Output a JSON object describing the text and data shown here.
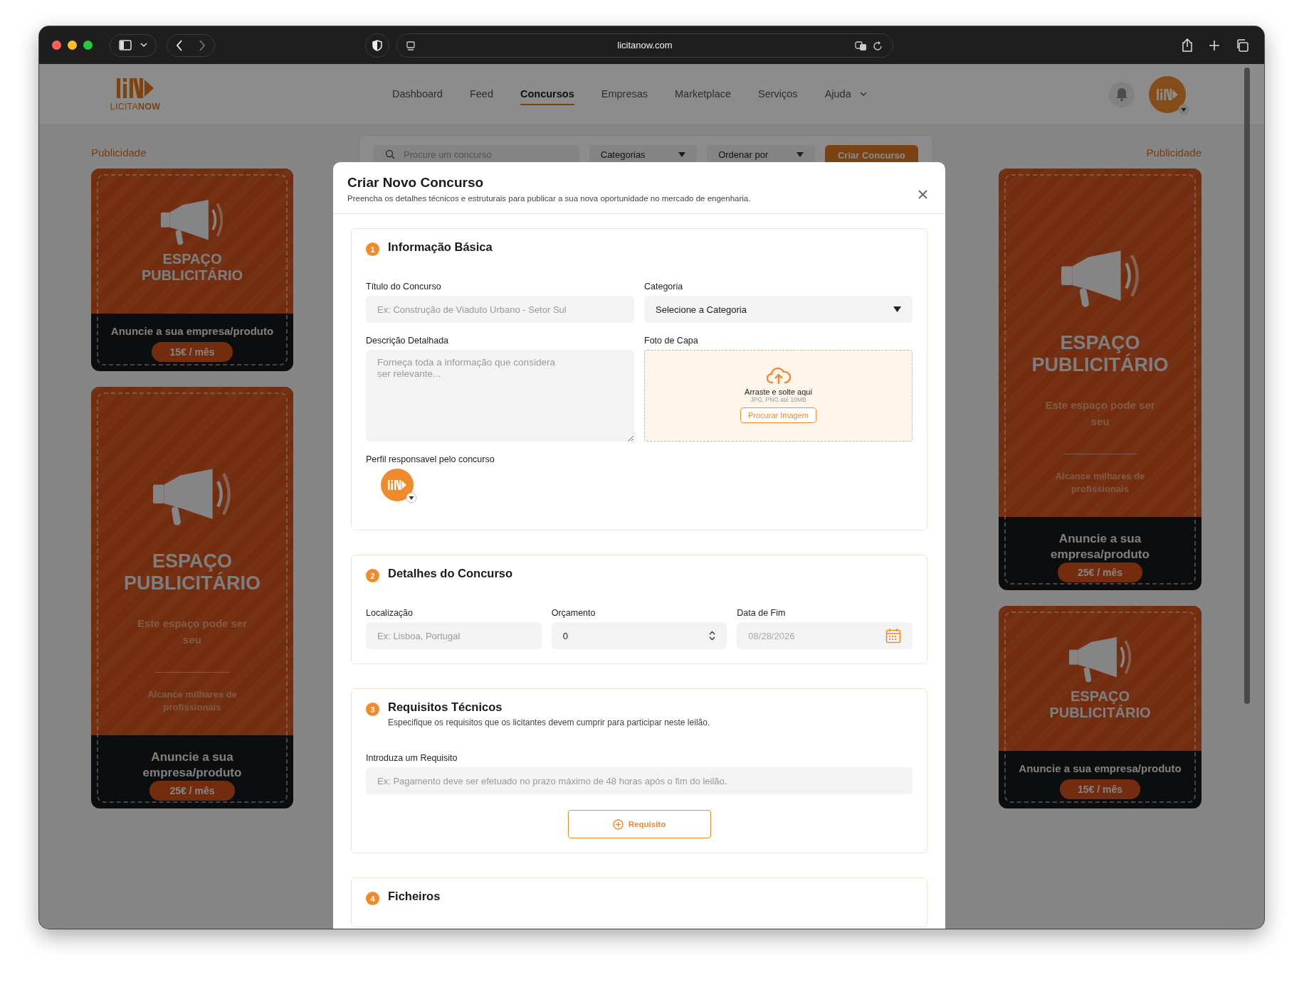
{
  "browser": {
    "url": "licitanow.com"
  },
  "header": {
    "brand": "LICITA**NOW**",
    "nav": [
      {
        "label": "Dashboard",
        "selected": false,
        "has_menu": false
      },
      {
        "label": "Feed",
        "selected": false,
        "has_menu": false
      },
      {
        "label": "Concursos",
        "selected": true,
        "has_menu": false
      },
      {
        "label": "Empresas",
        "selected": false,
        "has_menu": false
      },
      {
        "label": "Marketplace",
        "selected": false,
        "has_menu": false
      },
      {
        "label": "Serviços",
        "selected": false,
        "has_menu": false
      },
      {
        "label": "Ajuda",
        "selected": false,
        "has_menu": true
      }
    ]
  },
  "filters": {
    "search_placeholder": "Procure um concurso",
    "category": "Categorias",
    "sort": "Ordenar por",
    "create_button": "Criar Concurso"
  },
  "ads_left": {
    "label": "Publicidade",
    "ads": [
      {
        "kind": "small",
        "title": "ESPAÇO PUBLICITÁRIO",
        "cta": "Anuncie a sua empresa/produto",
        "price": "15€ / mês"
      },
      {
        "kind": "large",
        "title": "ESPAÇO PUBLICITÁRIO",
        "tagline": "Este espaço pode ser seu",
        "reach": "Alcance milhares de profissionais",
        "cta": "Anuncie a sua empresa/produto",
        "price": "25€ / mês"
      }
    ]
  },
  "ads_right": {
    "label": "Publicidade",
    "ads": [
      {
        "kind": "large",
        "title": "ESPAÇO PUBLICITÁRIO",
        "tagline": "Este espaço pode ser seu",
        "reach": "Alcance milhares de profissionais",
        "cta": "Anuncie a sua empresa/produto",
        "price": "25€ / mês"
      },
      {
        "kind": "small",
        "title": "ESPAÇO PUBLICITÁRIO",
        "cta": "Anuncie a sua empresa/produto",
        "price": "15€ / mês"
      }
    ]
  },
  "modal": {
    "title": "Criar Novo Concurso",
    "subtitle": "Preencha os detalhes técnicos e estruturais para publicar a sua nova oportunidade no mercado de engenharia.",
    "sections": [
      {
        "kind": "basic",
        "number": "1",
        "title": "Informação Básica",
        "fields": [
          {
            "kind": "text",
            "label": "Título do Concurso",
            "placeholder": "Ex: Construção de Viaduto Urbano - Setor Sul"
          },
          {
            "kind": "select",
            "label": "Categoria",
            "value": "Selecione a Categoria"
          },
          {
            "kind": "textarea",
            "label": "Descrição Detalhada",
            "placeholder": "Forneça toda a informação que considera ser relevante..."
          },
          {
            "kind": "upload",
            "label": "Foto de Capa",
            "prompt": "Arraste e solte aqui",
            "hint": "JPG, PNG até 10MB",
            "button": "Procurar Imagem"
          },
          {
            "kind": "profile",
            "label": "Perfil responsavel pelo concurso"
          }
        ]
      },
      {
        "kind": "details",
        "number": "2",
        "title": "Detalhes do Concurso",
        "fields": [
          {
            "kind": "text",
            "label": "Localização",
            "placeholder": "Ex: Lisboa, Portugal"
          },
          {
            "kind": "number",
            "label": "Orçamento",
            "value": "0"
          },
          {
            "kind": "date",
            "label": "Data de Fim",
            "placeholder": "08/28/2026"
          }
        ]
      },
      {
        "kind": "requirements",
        "number": "3",
        "title": "Requisitos Técnicos",
        "description": "Especifique os requisitos que os licitantes devem cumprir para participar neste leilão.",
        "fields": [
          {
            "kind": "text",
            "label": "Introduza um Requisito",
            "placeholder": "Ex: Pagamento deve ser efetuado no prazo máximo de 48 horas após o fim do leilão."
          }
        ],
        "action_button": "Requisito"
      },
      {
        "kind": "files",
        "number": "4",
        "title": "Ficheiros"
      }
    ]
  }
}
